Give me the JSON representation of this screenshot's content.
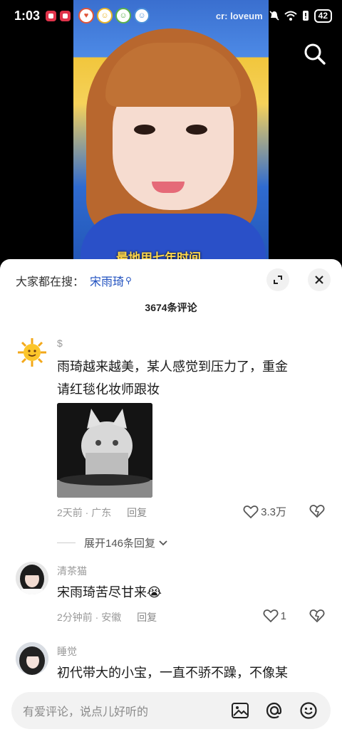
{
  "status_bar": {
    "time": "1:03",
    "watermark": "cr: loveum",
    "battery": "42"
  },
  "video": {
    "caption": "最地用七年时间"
  },
  "comments_sheet": {
    "suggest_prefix": "大家都在搜：",
    "suggest_term": "宋雨琦",
    "count_label": "3674条评论",
    "comments": [
      {
        "user": "$",
        "text_line1": "雨琦越来越美，某人感觉到压力了，重金",
        "text_line2": "请红毯化妆师跟妆",
        "time": "2天前 · 广东",
        "reply_label": "回复",
        "likes": "3.3万",
        "expand_label": "展开146条回复"
      },
      {
        "user": "清茶猫",
        "text": "宋雨琦苦尽甘来😭",
        "time": "2分钟前 · 安徽",
        "reply_label": "回复",
        "likes": "1"
      },
      {
        "user": "睡觉",
        "text_line1": "初代带大的小宝，一直不骄不躁，不像某"
      }
    ]
  },
  "input": {
    "placeholder": "有爱评论，说点儿好听的"
  },
  "icons": [
    "search-icon",
    "expand-icon",
    "close-icon",
    "heart-icon",
    "dislike-icon",
    "chevron-down-icon",
    "image-icon",
    "at-icon",
    "emoji-icon"
  ]
}
